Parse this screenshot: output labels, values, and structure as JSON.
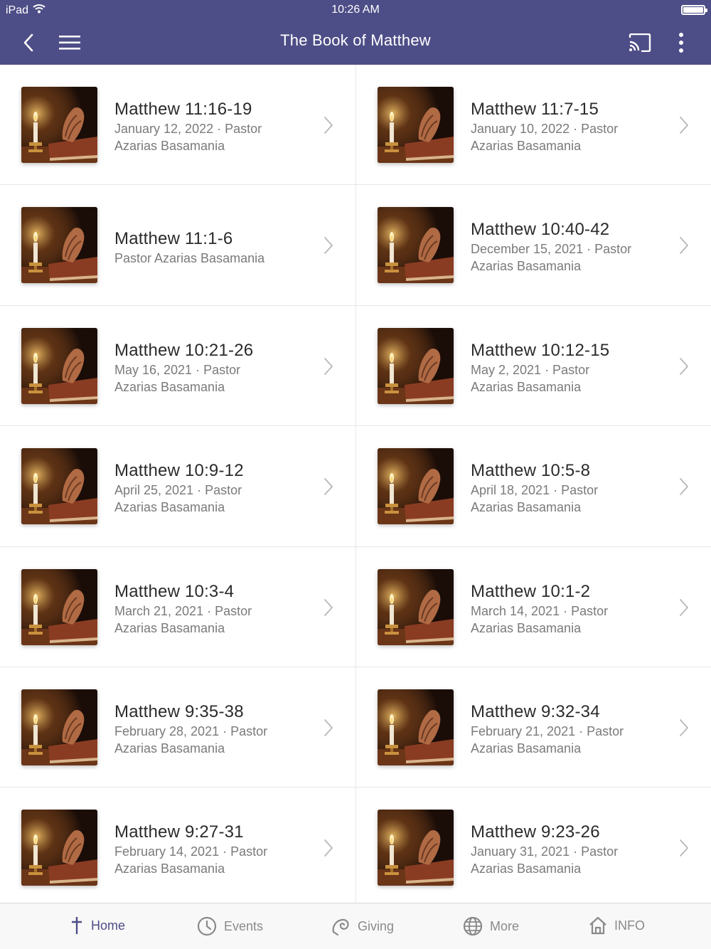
{
  "status_bar": {
    "device": "iPad",
    "time": "10:26 AM"
  },
  "header": {
    "title": "The Book of Matthew"
  },
  "sermons": [
    {
      "title": "Matthew 11:16-19",
      "line1": "January 12, 2022 · Pastor",
      "line2": "Azarias Basamania"
    },
    {
      "title": "Matthew 11:7-15",
      "line1": "January 10, 2022 · Pastor",
      "line2": "Azarias Basamania"
    },
    {
      "title": "Matthew 11:1-6",
      "line1": "Pastor Azarias Basamania",
      "line2": ""
    },
    {
      "title": "Matthew 10:40-42",
      "line1": "December 15, 2021 · Pastor",
      "line2": "Azarias Basamania"
    },
    {
      "title": "Matthew 10:21-26",
      "line1": "May 16, 2021 · Pastor",
      "line2": "Azarias Basamania"
    },
    {
      "title": "Matthew 10:12-15",
      "line1": "May 2, 2021 · Pastor",
      "line2": "Azarias Basamania"
    },
    {
      "title": "Matthew 10:9-12",
      "line1": "April 25, 2021 · Pastor",
      "line2": "Azarias Basamania"
    },
    {
      "title": "Matthew 10:5-8",
      "line1": "April 18, 2021 · Pastor",
      "line2": "Azarias Basamania"
    },
    {
      "title": "Matthew 10:3-4",
      "line1": "March 21, 2021 · Pastor",
      "line2": "Azarias Basamania"
    },
    {
      "title": "Matthew 10:1-2",
      "line1": "March 14, 2021 · Pastor",
      "line2": "Azarias Basamania"
    },
    {
      "title": "Matthew 9:35-38",
      "line1": "February 28, 2021 · Pastor",
      "line2": "Azarias Basamania"
    },
    {
      "title": "Matthew 9:32-34",
      "line1": "February 21, 2021 · Pastor",
      "line2": "Azarias Basamania"
    },
    {
      "title": "Matthew 9:27-31",
      "line1": "February 14, 2021 · Pastor",
      "line2": "Azarias Basamania"
    },
    {
      "title": "Matthew 9:23-26",
      "line1": "January 31, 2021 · Pastor",
      "line2": "Azarias Basamania"
    }
  ],
  "tabs": [
    {
      "label": "Home",
      "icon": "cross-icon",
      "active": true
    },
    {
      "label": "Events",
      "icon": "clock-icon",
      "active": false
    },
    {
      "label": "Giving",
      "icon": "giving-icon",
      "active": false
    },
    {
      "label": "More",
      "icon": "globe-icon",
      "active": false
    },
    {
      "label": "INFO",
      "icon": "house-icon",
      "active": false
    }
  ],
  "colors": {
    "header_bg": "#4d4d87",
    "accent": "#4d4d87",
    "inactive_tab": "#8a8a8a"
  }
}
